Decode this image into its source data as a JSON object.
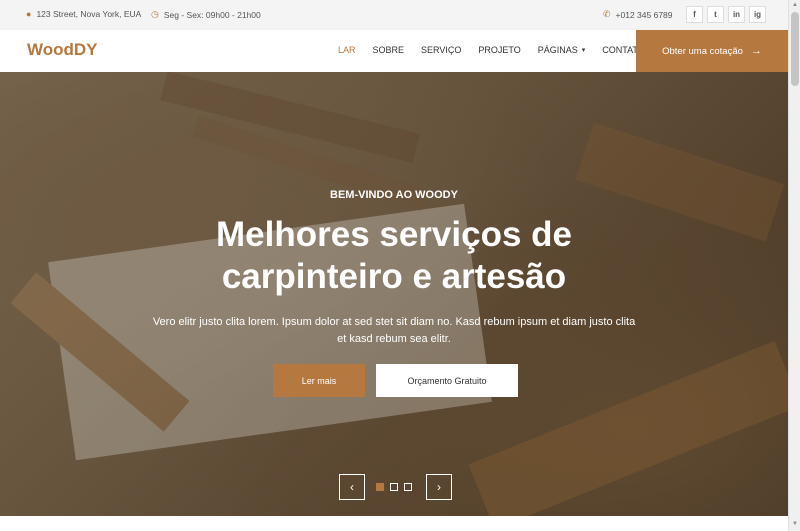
{
  "topbar": {
    "address": "123 Street, Nova York, EUA",
    "hours": "Seg - Sex: 09h00 - 21h00",
    "phone": "+012 345 6789",
    "socials": [
      "f",
      "t",
      "in",
      "ig"
    ]
  },
  "nav": {
    "brand": "WoodDY",
    "items": [
      "LAR",
      "SOBRE",
      "SERVIÇO",
      "PROJETO",
      "PÁGINAS",
      "CONTATO"
    ],
    "quote_label": "Obter uma cotação"
  },
  "hero": {
    "subtitle": "BEM-VINDO AO WOODY",
    "title_line1": "Melhores serviços de",
    "title_line2": "carpinteiro e artesão",
    "description": "Vero elitr justo clita lorem. Ipsum dolor at sed stet sit diam no. Kasd rebum ipsum et diam justo clita et kasd rebum sea elitr.",
    "primary_button": "Ler mais",
    "secondary_button": "Orçamento Gratuito"
  },
  "colors": {
    "accent": "#b5783f"
  },
  "icons": {
    "address": "map-marker-icon",
    "hours": "clock-icon",
    "phone": "phone-icon",
    "quote_arrow": "arrow-right-icon",
    "prev": "chevron-left-icon",
    "next": "chevron-right-icon"
  }
}
